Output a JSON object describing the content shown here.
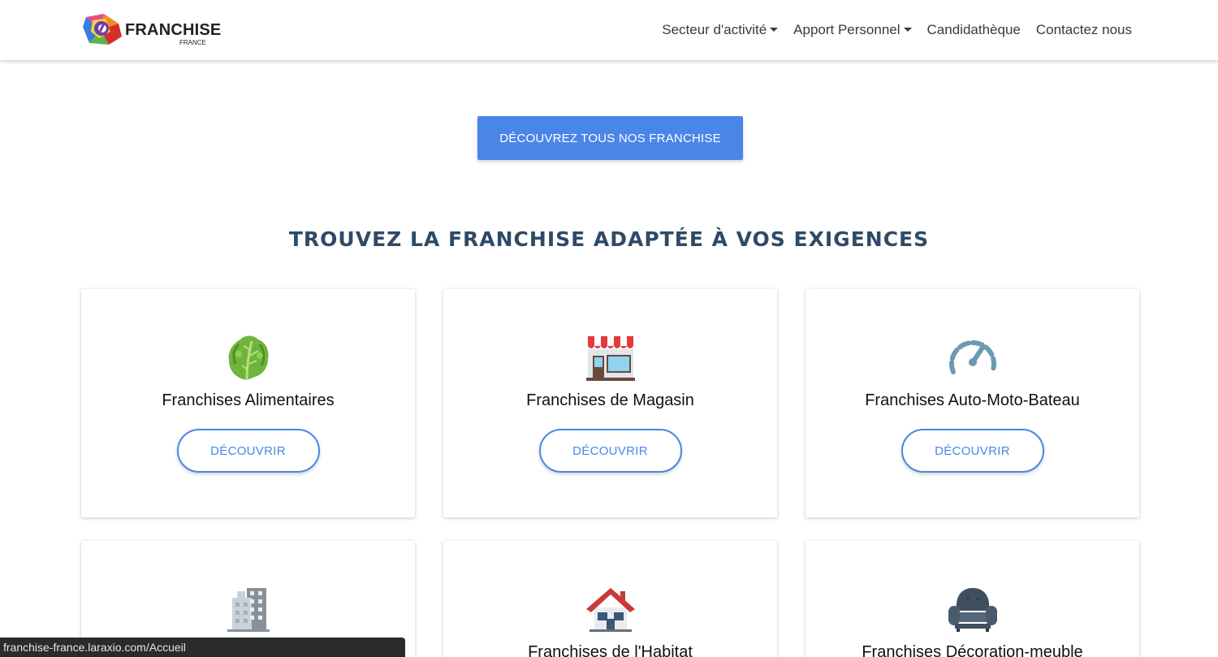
{
  "brand": {
    "name": "FRANCHISE",
    "subtitle": "FRANCE"
  },
  "nav": {
    "items": [
      {
        "label": "Secteur d'activité",
        "dropdown": true
      },
      {
        "label": "Apport Personnel",
        "dropdown": true
      },
      {
        "label": "Candidathèque",
        "dropdown": false
      },
      {
        "label": "Contactez nous",
        "dropdown": false
      }
    ]
  },
  "cta": {
    "label": "DÉCOUVREZ TOUS NOS FRANCHISE"
  },
  "section": {
    "title": "TROUVEZ LA FRANCHISE ADAPTÉE À VOS EXIGENCES"
  },
  "cards": [
    {
      "icon": "lettuce-icon",
      "title": "Franchises Alimentaires",
      "button": "DÉCOUVRIR"
    },
    {
      "icon": "store-icon",
      "title": "Franchises de Magasin",
      "button": "DÉCOUVRIR"
    },
    {
      "icon": "speedometer-icon",
      "title": "Franchises Auto-Moto-Bateau",
      "button": "DÉCOUVRIR"
    },
    {
      "icon": "office-building-icon",
      "title": "",
      "button": ""
    },
    {
      "icon": "house-icon",
      "title": "Franchises de l'Habitat",
      "button": ""
    },
    {
      "icon": "armchair-icon",
      "title": "Franchises Décoration-meuble",
      "button": ""
    }
  ],
  "status_url": "franchise-france.laraxio.com/Accueil",
  "colors": {
    "primary": "#4a86e8",
    "title": "#2e4a66"
  }
}
